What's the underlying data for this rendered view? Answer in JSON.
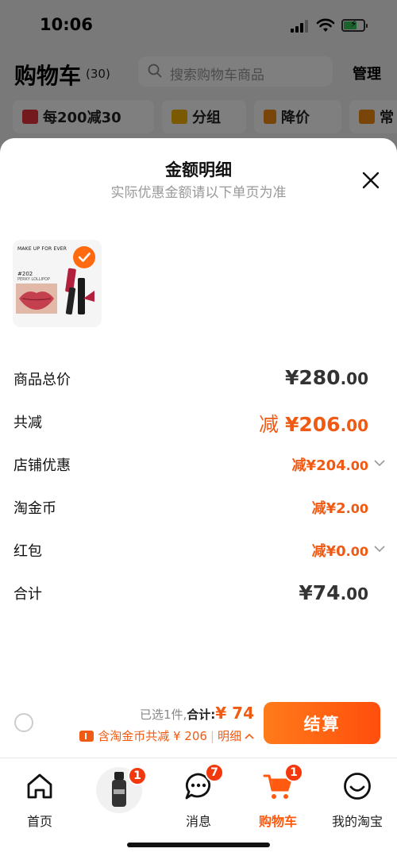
{
  "status_bar": {
    "time": "10:06"
  },
  "cart_header": {
    "title": "购物车",
    "count": "(30)",
    "search_placeholder": "搜索购物车商品",
    "manage_label": "管理"
  },
  "chips": [
    {
      "label": "每200减30",
      "icon": "coupon-icon"
    },
    {
      "label": "分组",
      "icon": "folder-icon"
    },
    {
      "label": "降价",
      "icon": "price-drop-icon"
    },
    {
      "label": "常",
      "icon": "cart-icon"
    }
  ],
  "sheet": {
    "title": "金额明细",
    "subtitle": "实际优惠金额请以下单页为准",
    "product": {
      "brand": "MAKE UP FOR EVER",
      "shade_no": "#202",
      "shade_name": "PERKY LOLLIPOP",
      "selected": true
    },
    "rows": [
      {
        "label": "商品总价",
        "prefix": "",
        "currency": "¥",
        "int": "280",
        "cents": ".00"
      },
      {
        "label": "共减",
        "prefix": "减 ",
        "currency": "¥",
        "int": "206",
        "cents": ".00"
      },
      {
        "label": "店铺优惠",
        "prefix": "减",
        "currency": "¥",
        "int": "204",
        "cents": ".00"
      },
      {
        "label": "淘金币",
        "prefix": "减",
        "currency": "¥",
        "int": "2",
        "cents": ".00"
      },
      {
        "label": "红包",
        "prefix": "减",
        "currency": "¥",
        "int": "0",
        "cents": ".00"
      },
      {
        "label": "合计",
        "prefix": "",
        "currency": "¥",
        "int": "74",
        "cents": ".00"
      }
    ],
    "footer": {
      "selected_text": "已选1件,",
      "total_label": "合计:",
      "total_amount": "¥ 74",
      "discount_text": "含淘金币共减 ¥ 206",
      "detail_label": "明细",
      "checkout_label": "结算"
    }
  },
  "tab_bar": {
    "tabs": [
      {
        "label": "首页",
        "badge": "",
        "icon": "home-icon"
      },
      {
        "label": "",
        "badge": "1",
        "icon": "product-thumb-icon"
      },
      {
        "label": "消息",
        "badge": "7",
        "icon": "message-icon"
      },
      {
        "label": "购物车",
        "badge": "1",
        "icon": "cart-icon"
      },
      {
        "label": "我的淘宝",
        "badge": "",
        "icon": "smile-icon"
      }
    ]
  },
  "colors": {
    "accent": "#ff5a0f",
    "discount": "#f05a12",
    "badge": "#f2380c"
  }
}
